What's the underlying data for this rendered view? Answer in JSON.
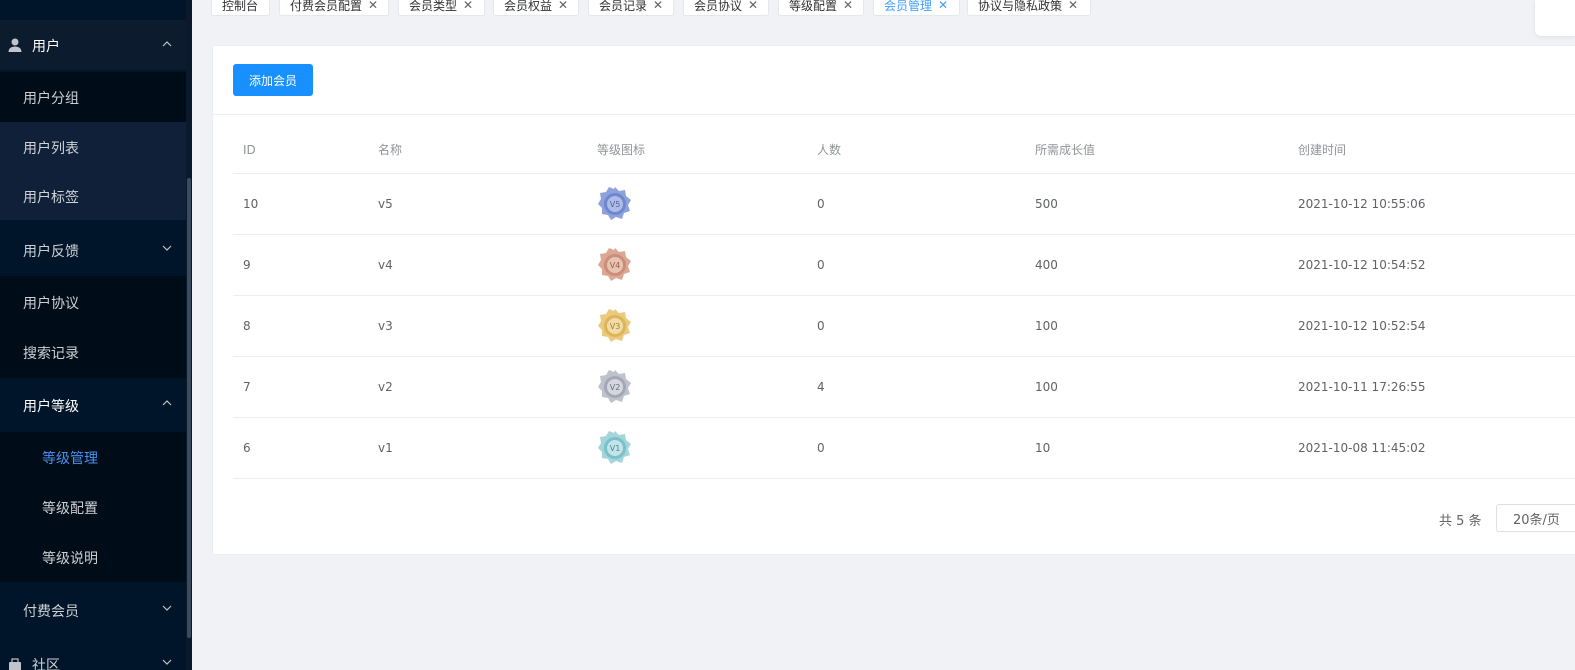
{
  "sidebar": {
    "top": {
      "label": "用户"
    },
    "items": [
      {
        "label": "用户分组"
      },
      {
        "label": "用户列表"
      },
      {
        "label": "用户标签"
      },
      {
        "label": "用户反馈"
      },
      {
        "label": "用户协议"
      },
      {
        "label": "搜索记录"
      },
      {
        "label": "用户等级"
      },
      {
        "label": "等级管理"
      },
      {
        "label": "等级配置"
      },
      {
        "label": "等级说明"
      },
      {
        "label": "付费会员"
      },
      {
        "label": "社区"
      }
    ]
  },
  "tabs": [
    {
      "label": "控制台"
    },
    {
      "label": "付费会员配置"
    },
    {
      "label": "会员类型"
    },
    {
      "label": "会员权益"
    },
    {
      "label": "会员记录"
    },
    {
      "label": "会员协议"
    },
    {
      "label": "等级配置"
    },
    {
      "label": "会员管理"
    },
    {
      "label": "协议与隐私政策"
    }
  ],
  "toolbar": {
    "add_label": "添加会员"
  },
  "table": {
    "headers": [
      "ID",
      "名称",
      "等级图标",
      "人数",
      "所需成长值",
      "创建时间"
    ],
    "rows": [
      {
        "id": "10",
        "name": "v5",
        "icon_text": "V5",
        "count": "0",
        "growth": "500",
        "created": "2021-10-12 10:55:06"
      },
      {
        "id": "9",
        "name": "v4",
        "icon_text": "V4",
        "count": "0",
        "growth": "400",
        "created": "2021-10-12 10:54:52"
      },
      {
        "id": "8",
        "name": "v3",
        "icon_text": "V3",
        "count": "0",
        "growth": "100",
        "created": "2021-10-12 10:52:54"
      },
      {
        "id": "7",
        "name": "v2",
        "icon_text": "V2",
        "count": "4",
        "growth": "100",
        "created": "2021-10-11 17:26:55"
      },
      {
        "id": "6",
        "name": "v1",
        "icon_text": "V1",
        "count": "0",
        "growth": "10",
        "created": "2021-10-08 11:45:02"
      }
    ]
  },
  "pagination": {
    "total": "共 5 条",
    "page_size": "20条/页"
  },
  "colors": {
    "sidebar_bg": "#001529",
    "accent": "#1890ff",
    "active_text": "#4a90f0",
    "badge_v5": "#6f87cf",
    "badge_v4": "#c98f7a",
    "badge_v3": "#dcb45a",
    "badge_v2": "#a3a8b6",
    "badge_v1": "#7cc0c8"
  }
}
